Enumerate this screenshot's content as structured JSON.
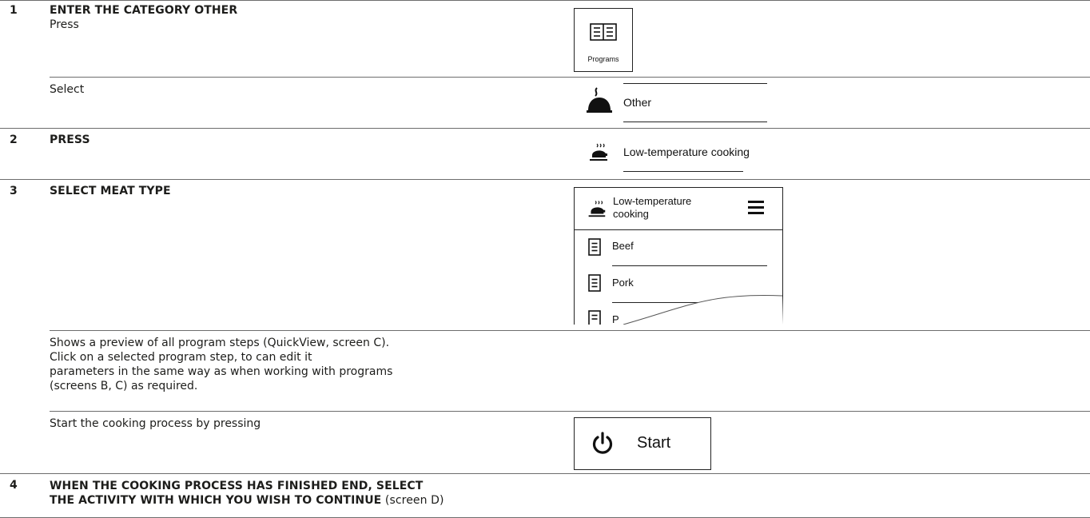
{
  "steps": [
    {
      "number": "1",
      "heading": "ENTER THE CATEGORY OTHER",
      "press_text": "Press",
      "select_text": "Select",
      "programs_button_label": "Programs",
      "other_item_label": "Other"
    },
    {
      "number": "2",
      "heading": "PRESS",
      "lowtemp_item_label": "Low-temperature cooking"
    },
    {
      "number": "3",
      "heading": "SELECT MEAT TYPE",
      "panel_title_line1": "Low-temperature",
      "panel_title_line2": "cooking",
      "list_items": [
        "Beef",
        "Pork",
        "P"
      ],
      "preview_lines": [
        "Shows a preview of all program steps (QuickView, screen C).",
        "Click on a selected program step, to can edit it",
        "parameters in the same way as when working with programs",
        "(screens B, C) as required."
      ],
      "start_text": "Start the cooking process by pressing",
      "start_button_label": "Start"
    },
    {
      "number": "4",
      "heading_line1": "WHEN THE COOKING PROCESS HAS FINISHED END, SELECT",
      "heading_line2": "THE ACTIVITY WITH WHICH YOU WISH TO CONTINUE",
      "heading_suffix": " (screen D)"
    }
  ]
}
